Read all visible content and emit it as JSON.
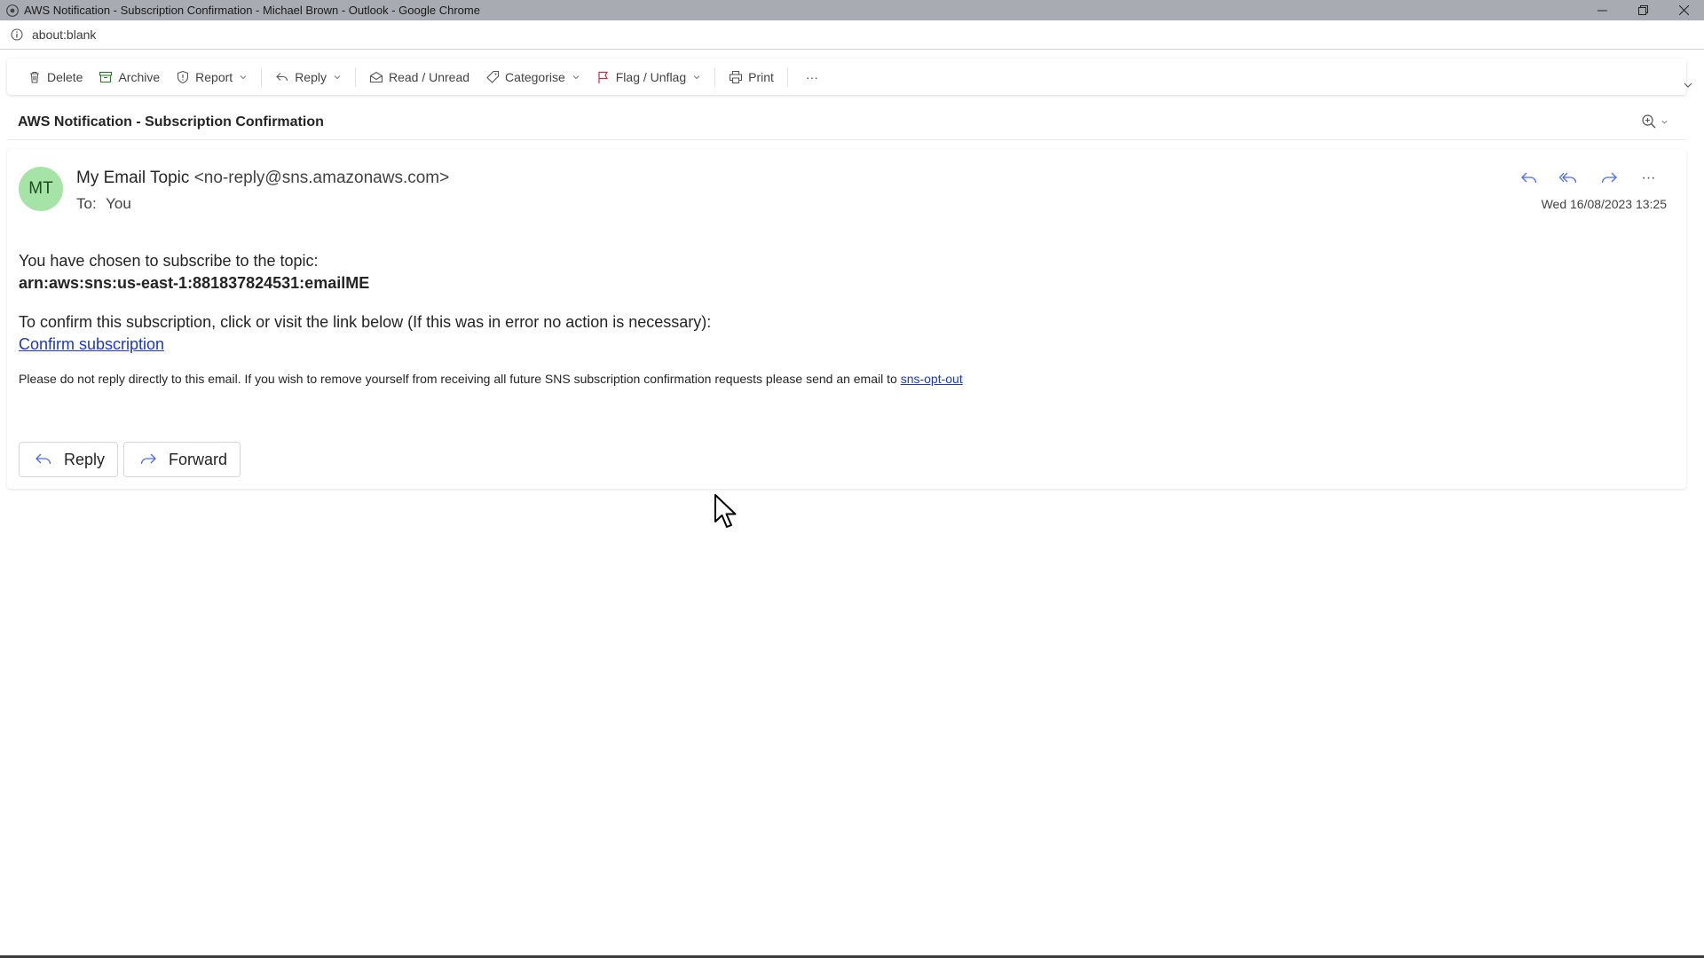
{
  "window": {
    "title": "AWS Notification - Subscription Confirmation - Michael Brown - Outlook - Google Chrome",
    "url": "about:blank"
  },
  "toolbar": {
    "delete": "Delete",
    "archive": "Archive",
    "report": "Report",
    "reply": "Reply",
    "read_unread": "Read / Unread",
    "categorise": "Categorise",
    "flag": "Flag / Unflag",
    "print": "Print",
    "more": "···"
  },
  "email": {
    "subject": "AWS Notification - Subscription Confirmation",
    "avatar_initials": "MT",
    "sender_name": "My Email Topic",
    "sender_address": "<no-reply@sns.amazonaws.com>",
    "to_label": "To:",
    "to_value": "You",
    "date": "Wed 16/08/2023 13:25",
    "actions_more": "···",
    "body": {
      "line1": "You have chosen to subscribe to the topic:",
      "arn": "arn:aws:sns:us-east-1:881837824531:emailME",
      "line2": "To confirm this subscription, click or visit the link below (If this was in error no action is necessary):",
      "confirm_link": "Confirm subscription",
      "footer": "Please do not reply directly to this email. If you wish to remove yourself from receiving all future SNS subscription confirmation requests please send an email to",
      "optout_link": "sns-opt-out"
    },
    "reply_button": "Reply",
    "forward_button": "Forward"
  },
  "icons": {
    "accent_link": "#1c39bb",
    "avatar_bg": "#a6e3a6",
    "titlebar_bg": "#a9abb3"
  }
}
